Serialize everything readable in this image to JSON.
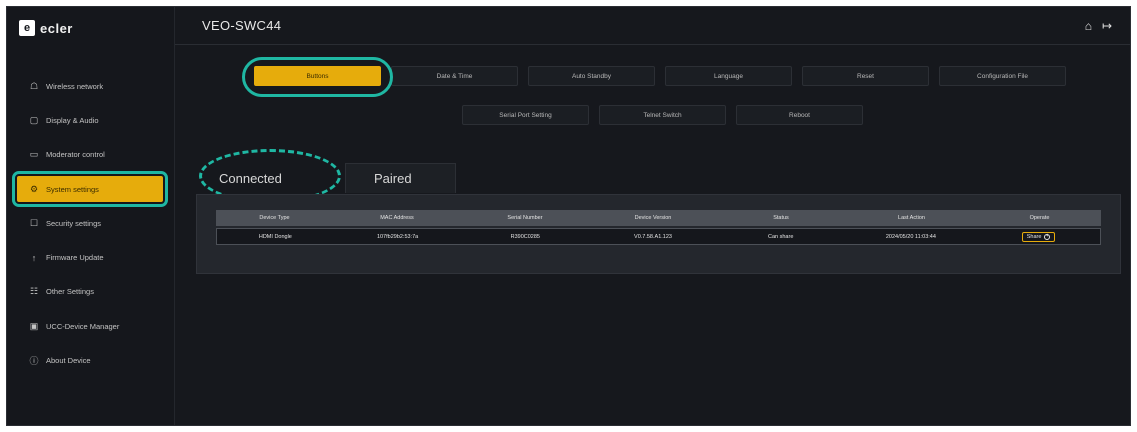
{
  "brand": {
    "name": "ecler",
    "sub": ""
  },
  "header": {
    "title": "VEO-SWC44",
    "home_icon": "home-icon",
    "logout_icon": "logout-icon"
  },
  "sidebar": {
    "items": [
      {
        "label": "Wireless network",
        "icon": "network-icon"
      },
      {
        "label": "Display & Audio",
        "icon": "display-icon"
      },
      {
        "label": "Moderator control",
        "icon": "monitor-icon"
      },
      {
        "label": "System settings",
        "icon": "gear-icon",
        "active": true
      },
      {
        "label": "Security settings",
        "icon": "lock-icon"
      },
      {
        "label": "Firmware Update",
        "icon": "upload-icon"
      },
      {
        "label": "Other Settings",
        "icon": "sliders-icon"
      },
      {
        "label": "UCC-Device Manager",
        "icon": "device-icon"
      },
      {
        "label": "About Device",
        "icon": "info-icon"
      }
    ]
  },
  "tabs": {
    "row1": [
      "Buttons",
      "Date & Time",
      "Auto Standby",
      "Language",
      "Reset",
      "Configuration File"
    ],
    "row2": [
      "Serial Port Setting",
      "Telnet Switch",
      "Reboot"
    ],
    "active": "Buttons"
  },
  "subtabs": {
    "connected": "Connected",
    "paired": "Paired"
  },
  "table": {
    "headers": [
      "Device Type",
      "MAC Address",
      "Serial Number",
      "Device Version",
      "Status",
      "Last Action",
      "Operate"
    ],
    "rows": [
      [
        "HDMI Dongle",
        "107fb29b2:53:7a",
        "R390C0285",
        "V0.7.58.A1.123",
        "Can share",
        "2024/05/20 11:03:44",
        "Share"
      ]
    ]
  },
  "colors": {
    "accent": "#e6ac0c",
    "highlight": "#1fb7a3",
    "background": "#16181d",
    "panel": "#24272d"
  }
}
